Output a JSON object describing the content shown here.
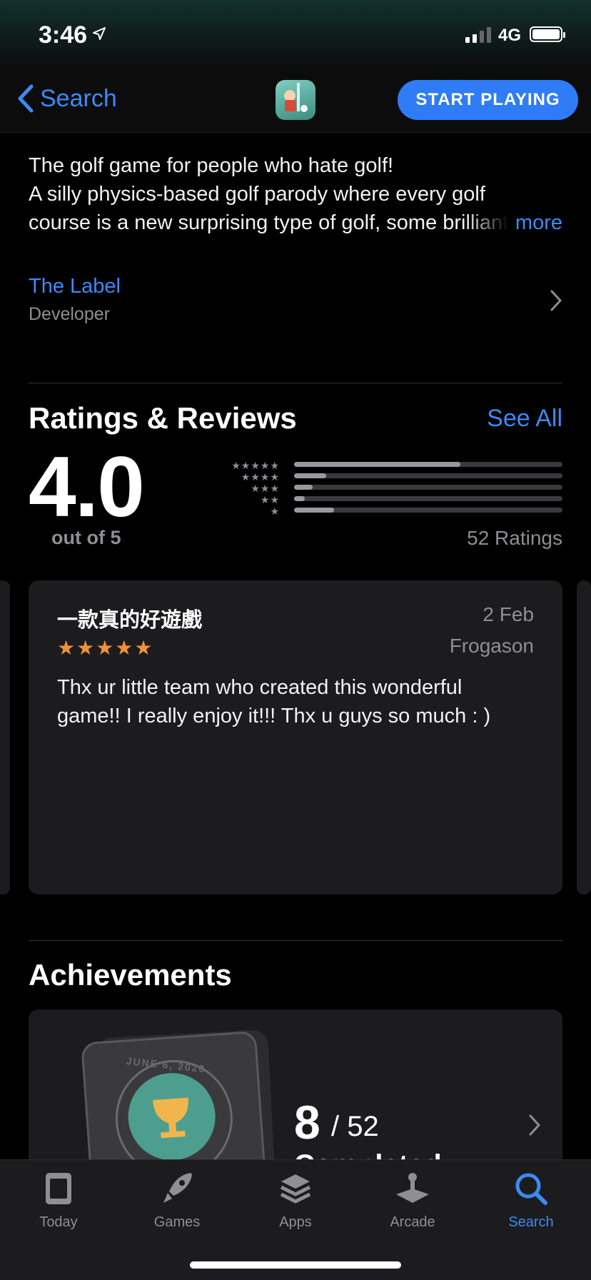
{
  "status_bar": {
    "time": "3:46",
    "network": "4G"
  },
  "nav": {
    "back_label": "Search",
    "cta_label": "START PLAYING"
  },
  "description": {
    "line1": "The golf game for people who hate golf!",
    "line2": "A silly physics-based golf parody where every golf",
    "line3": "course is a new surprising type of golf, some brilliant",
    "more_label": "more"
  },
  "developer": {
    "name": "The Label",
    "role": "Developer"
  },
  "ratings": {
    "heading": "Ratings & Reviews",
    "see_all": "See All",
    "score": "4.0",
    "out_of": "out of 5",
    "count_label": "52 Ratings",
    "distribution": [
      {
        "stars": "★★★★★",
        "fraction": 0.62
      },
      {
        "stars": "★★★★",
        "fraction": 0.12
      },
      {
        "stars": "★★★",
        "fraction": 0.07
      },
      {
        "stars": "★★",
        "fraction": 0.04
      },
      {
        "stars": "★",
        "fraction": 0.15
      }
    ]
  },
  "review": {
    "title": "一款真的好遊戲",
    "stars": "★★★★★",
    "date": "2 Feb",
    "author": "Frogason",
    "body": "Thx ur little team who created this wonderful game!! I really enjoy it!!! Thx u guys so much : )"
  },
  "achievements": {
    "heading": "Achievements",
    "badge_date": "JUNE 6, 2020",
    "completed": "8",
    "total": "/ 52",
    "label": "Completed"
  },
  "tabs": [
    {
      "label": "Today",
      "icon": "today-icon"
    },
    {
      "label": "Games",
      "icon": "rocket-icon"
    },
    {
      "label": "Apps",
      "icon": "layers-icon"
    },
    {
      "label": "Arcade",
      "icon": "joystick-icon"
    },
    {
      "label": "Search",
      "icon": "search-icon"
    }
  ],
  "colors": {
    "accent": "#3b8bf5",
    "star": "#f0913a",
    "cta": "#2f7cf6"
  }
}
